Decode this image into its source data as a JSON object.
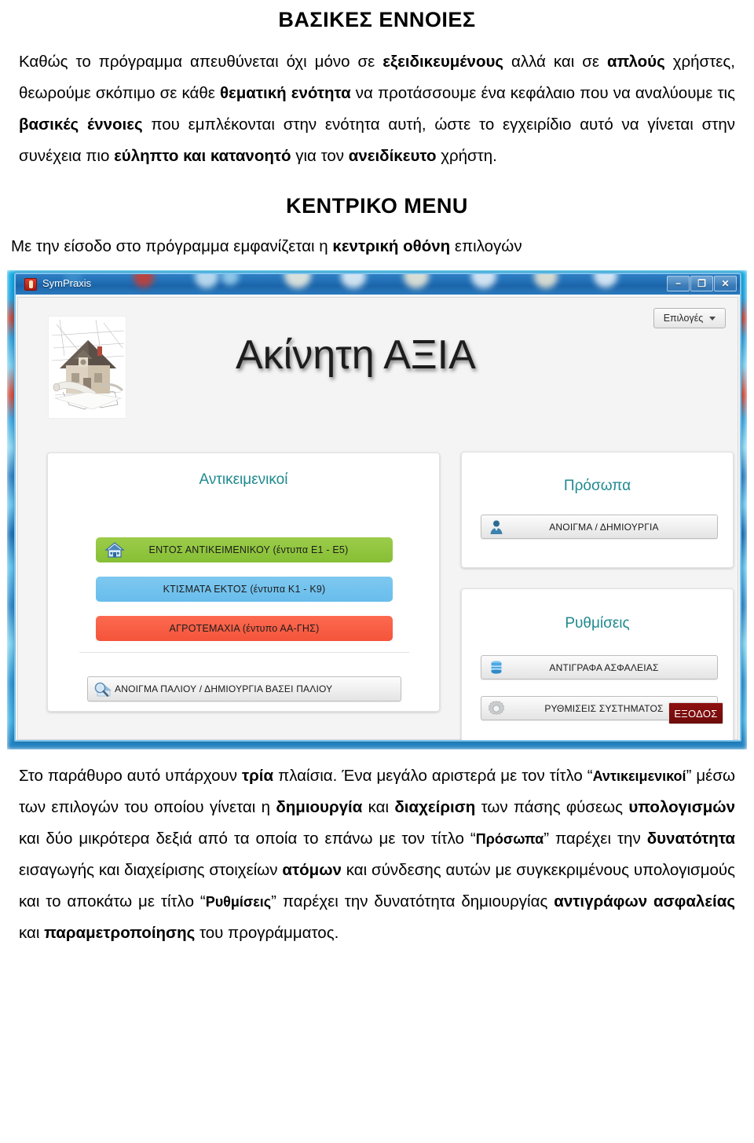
{
  "document": {
    "heading1": "ΒΑΣΙΚΕΣ ΕΝΝΟΙΕΣ",
    "intro_parts": {
      "p1a": "Καθώς το πρόγραμμα απευθύνεται όχι μόνο σε ",
      "p1b": "εξειδικευμένους",
      "p1c": " αλλά και σε ",
      "p1d": "απλούς",
      "p1e": " χρήστες, θεωρούμε σκόπιμο σε κάθε ",
      "p1f": "θεματική ενότητα",
      "p1g": " να προτάσσουμε ένα κεφάλαιο που να αναλύουμε τις ",
      "p1h": "βασικές έννοιες",
      "p1i": " που εμπλέκονται στην ενότητα αυτή, ώστε το εγχειρίδιο αυτό να γίνεται στην συνέχεια πιο ",
      "p1j": "εύληπτο και κατανοητό",
      "p1k": " για τον ",
      "p1l": "ανειδίκευτο",
      "p1m": " χρήστη."
    },
    "heading2": "ΚΕΝΤΡΙΚΟ MENU",
    "lead_parts": {
      "a": "Με την είσοδο στο πρόγραμμα εμφανίζεται η ",
      "b": "κεντρική οθόνη",
      "c": " επιλογών"
    },
    "outro_parts": {
      "a": "Στο παράθυρο αυτό υπάρχουν ",
      "b": "τρία",
      "c": " πλαίσια. Ένα μεγάλο αριστερά με τον τίτλο “",
      "d": "Αντικειμενικοί",
      "e": "” μέσω των επιλογών του οποίου γίνεται η ",
      "f": "δημιουργία",
      "g": " και ",
      "h": "διαχείριση",
      "i": " των πάσης φύσεως ",
      "j": "υπολογισμών",
      "k": " και δύο μικρότερα δεξιά από τα οποία το επάνω με τον τίτλο “",
      "l": "Πρόσωπα",
      "m": "” παρέχει την ",
      "n": "δυνατότητα",
      "o": " εισαγωγής και διαχείρισης στοιχείων ",
      "p": "ατόμων",
      "q": " και σύνδεσης αυτών με συγκεκριμένους υπολογισμούς και το αποκάτω με τίτλο “",
      "r": "Ρυθμίσεις",
      "s": "” παρέχει την δυνατότητα δημιουργίας ",
      "t": "αντιγράφων",
      "u": " ",
      "v": "ασφαλείας",
      "w": " και ",
      "x": "παραμετροποίησης",
      "y": " του προγράμματος."
    }
  },
  "app": {
    "window_title": "SymPraxis",
    "titlebar_buttons": {
      "minimize": "−",
      "maximize": "❐",
      "close": "✕"
    },
    "options_button": "Επιλογές",
    "brand_title": "Ακίνητη ΑΞΙΑ",
    "panels": {
      "objective": {
        "title": "Αντικειμενικοί",
        "buttons": [
          {
            "label": "ΕΝΤΟΣ ΑΝΤΙΚΕΙΜΕΝΙΚΟΥ (έντυπα Ε1 - Ε5)",
            "color": "#92c83e",
            "icon": "house-icon"
          },
          {
            "label": "ΚΤΙΣΜΑΤΑ ΕΚΤΟΣ (έντυπα Κ1 - Κ9)",
            "color": "#72c1ee",
            "icon": "none"
          },
          {
            "label": "ΑΓΡΟΤΕΜΑΧΙΑ (έντυπο ΑΑ-ΓΗΣ)",
            "color": "#f85b40",
            "icon": "none"
          }
        ],
        "open_old_button": "ΑΝΟΙΓΜΑ ΠΑΛΙΟΥ / ΔΗΜΙΟΥΡΓΙΑ ΒΑΣΕΙ ΠΑΛΙΟΥ",
        "open_old_icon": "house-search-icon"
      },
      "persons": {
        "title": "Πρόσωπα",
        "button": "ΑΝΟΙΓΜΑ / ΔΗΜΙΟΥΡΓΙΑ",
        "icon": "person-icon"
      },
      "settings": {
        "title": "Ρυθμίσεις",
        "buttons": [
          {
            "label": "ΑΝΤΙΓΡΑΦΑ ΑΣΦΑΛΕΙΑΣ",
            "icon": "database-icon"
          },
          {
            "label": "ΡΥΘΜΙΣΕΙΣ ΣΥΣΤΗΜΑΤΟΣ",
            "icon": "gear-icon"
          }
        ]
      }
    },
    "exit_button": "ΕΞΟΔΟΣ",
    "colors": {
      "panel_title": "#1f8a8f",
      "titlebar": "#1e6bb2",
      "exit": "#7e0d0d",
      "green": "#92c83e",
      "blue": "#72c1ee",
      "red": "#f85b40"
    }
  }
}
